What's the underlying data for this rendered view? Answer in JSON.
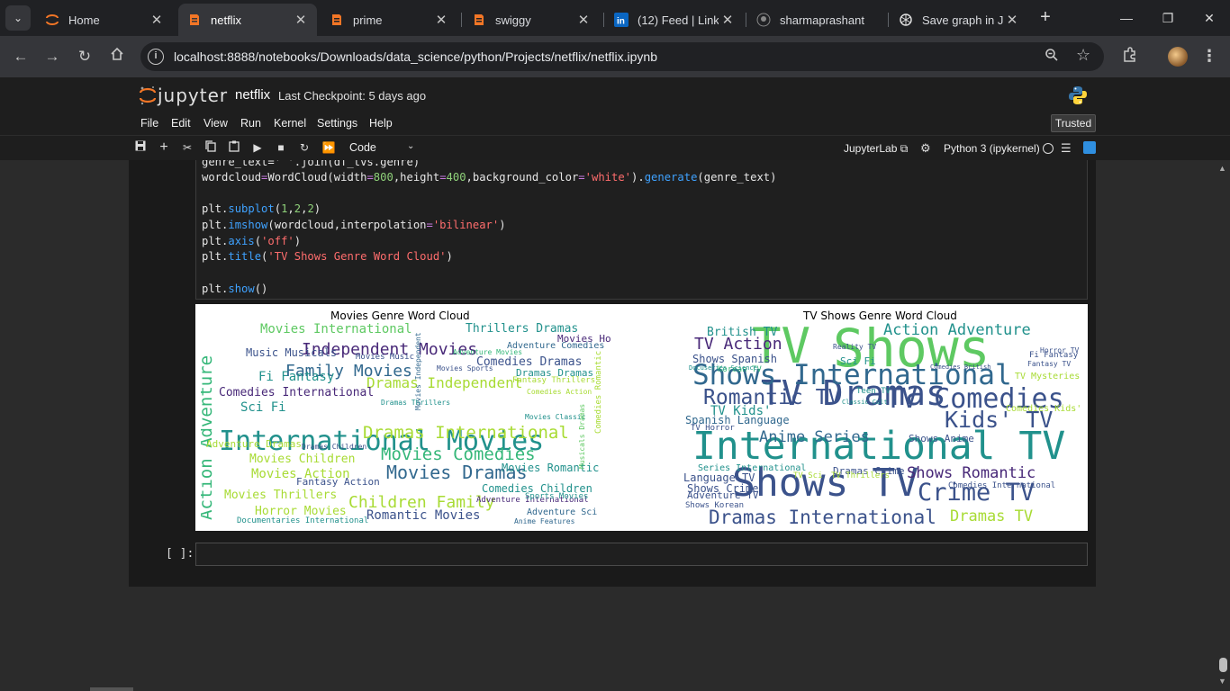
{
  "browser": {
    "tabs": [
      {
        "title": "Home",
        "icon": "jupyter-icon"
      },
      {
        "title": "netflix",
        "icon": "notebook-icon",
        "active": true
      },
      {
        "title": "prime",
        "icon": "notebook-icon"
      },
      {
        "title": "swiggy",
        "icon": "notebook-icon"
      },
      {
        "title": "(12) Feed | Linke",
        "icon": "linkedin-icon"
      },
      {
        "title": "sharmaprashant",
        "icon": "github-icon"
      },
      {
        "title": "Save graph in Ju",
        "icon": "chatgpt-icon"
      }
    ],
    "close_glyph": "✕",
    "new_tab_glyph": "+",
    "url": "localhost:8888/notebooks/Downloads/data_science/python/Projects/netflix/netflix.ipynb"
  },
  "jupyter": {
    "logo_text": "jupyter",
    "notebook_name": "netflix",
    "checkpoint": "Last Checkpoint: 5 days ago",
    "menu": [
      "File",
      "Edit",
      "View",
      "Run",
      "Kernel",
      "Settings",
      "Help"
    ],
    "trusted": "Trusted",
    "cell_type": "Code",
    "jupyterlab_link": "JupyterLab",
    "kernel": "Python 3 (ipykernel)"
  },
  "cell": {
    "code_lines": [
      "genre_text=' '.join(df_tvs.genre)",
      "wordcloud=WordCloud(width=800,height=400,background_color='white').generate(genre_text)",
      "",
      "plt.subplot(1,2,2)",
      "plt.imshow(wordcloud,interpolation='bilinear')",
      "plt.axis('off')",
      "plt.title('TV Shows Genre Word Cloud')",
      "",
      "plt.show()"
    ],
    "next_prompt": "[ ]:"
  },
  "output": {
    "left_title": "Movies Genre Word Cloud",
    "right_title": "TV Shows Genre Word Cloud",
    "palette": [
      "#440154",
      "#3b528b",
      "#21918c",
      "#5ec962",
      "#a8db34",
      "#31688e",
      "#35b779",
      "#482878"
    ],
    "left_words": [
      {
        "t": "International Movies",
        "c": 2
      },
      {
        "t": "Independent Movies",
        "c": 7
      },
      {
        "t": "Dramas International",
        "c": 4
      },
      {
        "t": "Movies Comedies",
        "c": 6
      },
      {
        "t": "Movies Dramas",
        "c": 5
      },
      {
        "t": "Children Family",
        "c": 4
      },
      {
        "t": "Family Movies",
        "c": 5
      },
      {
        "t": "Action Adventure",
        "c": 6
      },
      {
        "t": "Movies International",
        "c": 3
      },
      {
        "t": "Dramas Independent",
        "c": 4
      },
      {
        "t": "Comedies International",
        "c": 7
      },
      {
        "t": "Comedies Dramas",
        "c": 1
      },
      {
        "t": "Fi Fantasy",
        "c": 2
      },
      {
        "t": "Romantic Movies",
        "c": 1
      },
      {
        "t": "Sci Fi",
        "c": 2
      },
      {
        "t": "Movies Action",
        "c": 4
      },
      {
        "t": "Movies Children",
        "c": 4
      },
      {
        "t": "Movies Thrillers",
        "c": 4
      },
      {
        "t": "Horror Movies",
        "c": 4
      },
      {
        "t": "Comedies Children",
        "c": 2
      },
      {
        "t": "Thrillers Dramas",
        "c": 2
      },
      {
        "t": "Music Musicals",
        "c": 1
      },
      {
        "t": "Movies Horror",
        "c": 7
      },
      {
        "t": "Adventure Comedies",
        "c": 5
      },
      {
        "t": "Movies Romantic",
        "c": 2
      },
      {
        "t": "Adventure Dramas",
        "c": 4
      },
      {
        "t": "Fantasy Action",
        "c": 1
      },
      {
        "t": "Adventure International",
        "c": 7
      },
      {
        "t": "Dramas Dramas",
        "c": 2
      },
      {
        "t": "Sports Movies",
        "c": 2
      },
      {
        "t": "Movies Music",
        "c": 1
      },
      {
        "t": "Adventure Sci",
        "c": 5
      },
      {
        "t": "Documentaries International",
        "c": 2
      },
      {
        "t": "Dramas Children",
        "c": 1
      },
      {
        "t": "Fantasy Thrillers",
        "c": 4
      },
      {
        "t": "Anime Features",
        "c": 5
      },
      {
        "t": "Comedies Action",
        "c": 4
      },
      {
        "t": "Movies Classic",
        "c": 2
      },
      {
        "t": "Comedies Romantic",
        "c": 4
      },
      {
        "t": "Movies Independent",
        "c": 5
      },
      {
        "t": "Dramas Thrillers",
        "c": 2
      },
      {
        "t": "Adventure Movies",
        "c": 6
      },
      {
        "t": "Musicals Dramas",
        "c": 3
      },
      {
        "t": "Movies Sports",
        "c": 1
      }
    ],
    "right_words": [
      {
        "t": "Shows",
        "c": 3
      },
      {
        "t": "TV",
        "c": 3
      },
      {
        "t": "International TV",
        "c": 2
      },
      {
        "t": "TV Dramas",
        "c": 1
      },
      {
        "t": "Shows TV",
        "c": 1
      },
      {
        "t": "Shows International",
        "c": 5
      },
      {
        "t": "TV Comedies",
        "c": 1
      },
      {
        "t": "Romantic TV",
        "c": 1
      },
      {
        "t": "Kids' TV",
        "c": 1
      },
      {
        "t": "Crime TV",
        "c": 1
      },
      {
        "t": "Dramas International",
        "c": 1
      },
      {
        "t": "Dramas TV",
        "c": 4
      },
      {
        "t": "Shows Romantic",
        "c": 7
      },
      {
        "t": "Action Adventure",
        "c": 2
      },
      {
        "t": "TV Action",
        "c": 7
      },
      {
        "t": "Anime Series",
        "c": 5
      },
      {
        "t": "TV Kids'",
        "c": 2
      },
      {
        "t": "Spanish Language",
        "c": 5
      },
      {
        "t": "Shows Spanish",
        "c": 1
      },
      {
        "t": "British TV",
        "c": 2
      },
      {
        "t": "Language TV",
        "c": 1
      },
      {
        "t": "Shows Crime",
        "c": 1
      },
      {
        "t": "Adventure TV",
        "c": 1
      },
      {
        "t": "Series International",
        "c": 2
      },
      {
        "t": "Dramas Crime",
        "c": 1
      },
      {
        "t": "Shows Korean",
        "c": 1
      },
      {
        "t": "Shows Anime",
        "c": 1
      },
      {
        "t": "Fi Fantasy",
        "c": 1
      },
      {
        "t": "Sci Fi",
        "c": 2
      },
      {
        "t": "TV Horror",
        "c": 1
      },
      {
        "t": "Korean TV",
        "c": 6
      },
      {
        "t": "Teen TV",
        "c": 2
      },
      {
        "t": "TV Mysteries",
        "c": 4
      },
      {
        "t": "Comedies International",
        "c": 1
      },
      {
        "t": "Comedies Kids'",
        "c": 4
      },
      {
        "t": "Fantasy TV",
        "c": 1
      },
      {
        "t": "Reality TV",
        "c": 1
      },
      {
        "t": "Horror TV",
        "c": 1
      },
      {
        "t": "TV Sci",
        "c": 4
      },
      {
        "t": "TV Thrillers",
        "c": 4
      },
      {
        "t": "Docuseries Science",
        "c": 2
      },
      {
        "t": "Classic Cult",
        "c": 2
      },
      {
        "t": "Comedies British",
        "c": 1
      }
    ]
  }
}
